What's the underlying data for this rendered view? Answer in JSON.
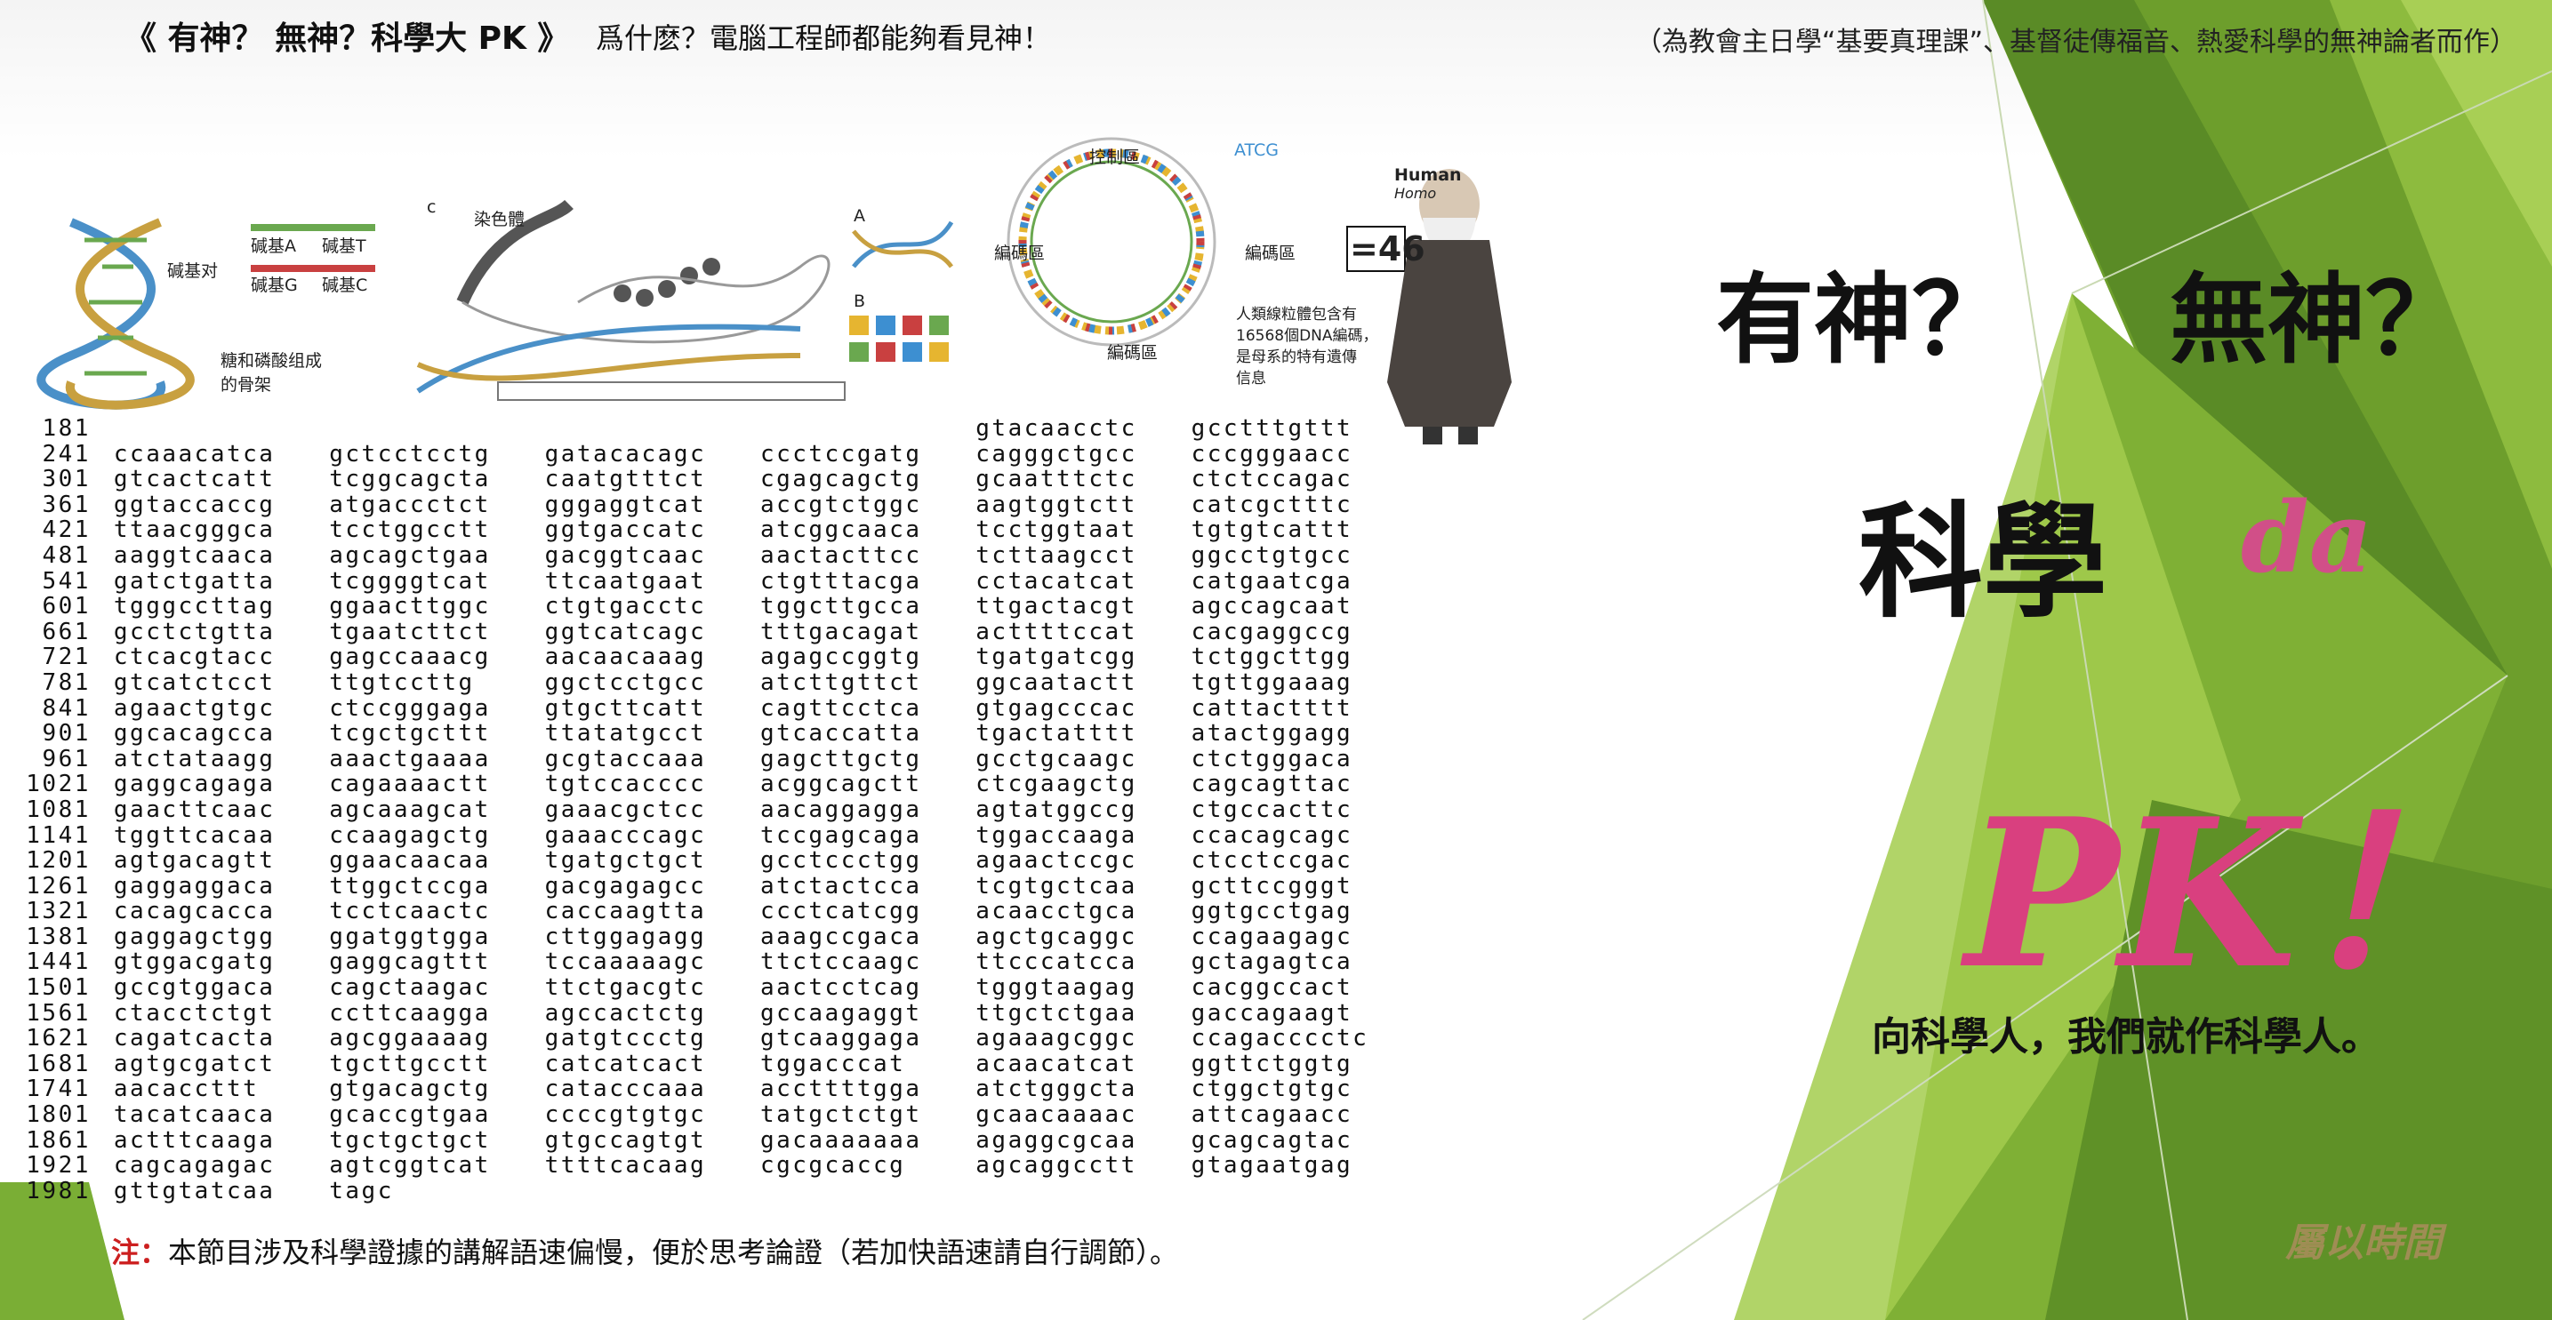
{
  "header": {
    "title": "《 有神？ 無神？科學大 PK 》",
    "subtitle": "爲什麽？電腦工程師都能夠看見神！",
    "note": "（為教會主日學“基要真理課”、基督徒傳福音、熱愛科學的無神論者而作）"
  },
  "hero": {
    "you_shen": "有神？",
    "wu_shen": "無神？",
    "science": "科學",
    "da": "da",
    "pk": "PK！",
    "slogan": "向科學人，我們就作科學人。",
    "watermark": "屬以時間"
  },
  "illustrations": {
    "base_pair": "碱基对",
    "base_a": "碱基A",
    "base_t": "碱基T",
    "base_g": "碱基G",
    "base_c": "碱基C",
    "backbone": "糖和磷酸组成\n的骨架",
    "chromosome": "染色體",
    "mito_control": "控制區",
    "coding_left": "編碼區",
    "coding_right": "編碼區",
    "coding_bottom": "編碼區",
    "mito_desc": "人類線粒體包含有\n16568個DNA編碼，\n是母系的特有遺傳\n信息",
    "human": "Human",
    "homo": "Homo",
    "chromosome_count": "=46",
    "panel_a": "A",
    "panel_b": "B",
    "panel_c": "c",
    "atcg": "ATCG"
  },
  "dna_sequence": [
    {
      "n": "181",
      "s": [
        "",
        "",
        "",
        "",
        "gtacaacctc",
        "gcctttgttt"
      ]
    },
    {
      "n": "241",
      "s": [
        "ccaaacatca",
        "gctcctcctg",
        "gatacacagc",
        "ccctccgatg",
        "cagggctgcc",
        "cccgggaacc"
      ]
    },
    {
      "n": "301",
      "s": [
        "gtcactcatt",
        "tcggcagcta",
        "caatgtttct",
        "cgagcagctg",
        "gcaatttctc",
        "ctctccagac"
      ]
    },
    {
      "n": "361",
      "s": [
        "ggtaccaccg",
        "atgaccctct",
        "gggaggtcat",
        "accgtctggc",
        "aagtggtctt",
        "catcgctttc"
      ]
    },
    {
      "n": "421",
      "s": [
        "ttaacgggca",
        "tcctggcctt",
        "ggtgaccatc",
        "atcggcaaca",
        "tcctggtaat",
        "tgtgtcattt"
      ]
    },
    {
      "n": "481",
      "s": [
        "aaggtcaaca",
        "agcagctgaa",
        "gacggtcaac",
        "aactacttcc",
        "tcttaagcct",
        "ggcctgtgcc"
      ]
    },
    {
      "n": "541",
      "s": [
        "gatctgatta",
        "tcggggtcat",
        "ttcaatgaat",
        "ctgtttacga",
        "cctacatcat",
        "catgaatcga"
      ]
    },
    {
      "n": "601",
      "s": [
        "tgggccttag",
        "ggaacttggc",
        "ctgtgacctc",
        "tggcttgcca",
        "ttgactacgt",
        "agccagcaat"
      ]
    },
    {
      "n": "661",
      "s": [
        "gcctctgtta",
        "tgaatcttct",
        "ggtcatcagc",
        "tttgacagat",
        "acttttccat",
        "cacgaggccg"
      ]
    },
    {
      "n": "721",
      "s": [
        "ctcacgtacc",
        "gagccaaacg",
        "aacaacaaag",
        "agagccggtg",
        "tgatgatcgg",
        "tctggcttgg"
      ]
    },
    {
      "n": "781",
      "s": [
        "gtcatctcct",
        "ttgtccttg",
        "ggctcctgcc",
        "atcttgttct",
        "ggcaatactt",
        "tgttggaaag"
      ]
    },
    {
      "n": "841",
      "s": [
        "agaactgtgc",
        "ctccgggaga",
        "gtgcttcatt",
        "cagttcctca",
        "gtgagcccac",
        "cattactttt"
      ]
    },
    {
      "n": "901",
      "s": [
        "ggcacagcca",
        "tcgctgcttt",
        "ttatatgcct",
        "gtcaccatta",
        "tgactatttt",
        "atactggagg"
      ]
    },
    {
      "n": "961",
      "s": [
        "atctataagg",
        "aaactgaaaa",
        "gcgtaccaaa",
        "gagcttgctg",
        "gcctgcaagc",
        "ctctgggaca"
      ]
    },
    {
      "n": "1021",
      "s": [
        "gaggcagaga",
        "cagaaaactt",
        "tgtccacccc",
        "acggcagctt",
        "ctcgaagctg",
        "cagcagttac"
      ]
    },
    {
      "n": "1081",
      "s": [
        "gaacttcaac",
        "agcaaagcat",
        "gaaacgctcc",
        "aacaggagga",
        "agtatggccg",
        "ctgccacttc"
      ]
    },
    {
      "n": "1141",
      "s": [
        "tggttcacaa",
        "ccaagagctg",
        "gaaacccagc",
        "tccgagcaga",
        "tggaccaaga",
        "ccacagcagc"
      ]
    },
    {
      "n": "1201",
      "s": [
        "agtgacagtt",
        "ggaacaacaa",
        "tgatgctgct",
        "gcctccctgg",
        "agaactccgc",
        "ctcctccgac"
      ]
    },
    {
      "n": "1261",
      "s": [
        "gaggaggaca",
        "ttggctccga",
        "gacgagagcc",
        "atctactcca",
        "tcgtgctcaa",
        "gcttccgggt"
      ]
    },
    {
      "n": "1321",
      "s": [
        "cacagcacca",
        "tcctcaactc",
        "caccaagtta",
        "ccctcatcgg",
        "acaacctgca",
        "ggtgcctgag"
      ]
    },
    {
      "n": "1381",
      "s": [
        "gaggagctgg",
        "ggatggtgga",
        "cttggagagg",
        "aaagccgaca",
        "agctgcaggc",
        "ccagaagagc"
      ]
    },
    {
      "n": "1441",
      "s": [
        "gtggacgatg",
        "gaggcagttt",
        "tccaaaaagc",
        "ttctccaagc",
        "ttcccatcca",
        "gctagagtca"
      ]
    },
    {
      "n": "1501",
      "s": [
        "gccgtggaca",
        "cagctaagac",
        "ttctgacgtc",
        "aactcctcag",
        "tgggtaagag",
        "cacggccact"
      ]
    },
    {
      "n": "1561",
      "s": [
        "ctacctctgt",
        "ccttcaagga",
        "agccactctg",
        "gccaagaggt",
        "ttgctctgaa",
        "gaccagaagt"
      ]
    },
    {
      "n": "1621",
      "s": [
        "cagatcacta",
        "agcggaaaag",
        "gatgtccctg",
        "gtcaaggaga",
        "agaaagcggc",
        "ccagacccctc"
      ]
    },
    {
      "n": "1681",
      "s": [
        "agtgcgatct",
        "tgcttgcctt",
        "catcatcact",
        "tggacccat",
        "acaacatcat",
        "ggttctggtg"
      ]
    },
    {
      "n": "1741",
      "s": [
        "aacaccttt",
        "gtgacagctg",
        "catacccaaa",
        "accttttgga",
        "atctgggcta",
        "ctggctgtgc"
      ]
    },
    {
      "n": "1801",
      "s": [
        "tacatcaaca",
        "gcaccgtgaa",
        "ccccgtgtgc",
        "tatgctctgt",
        "gcaacaaaac",
        "attcagaacc"
      ]
    },
    {
      "n": "1861",
      "s": [
        "actttcaaga",
        "tgctgctgct",
        "gtgccagtgt",
        "gacaaaaaaa",
        "agaggcgcaa",
        "gcagcagtac"
      ]
    },
    {
      "n": "1921",
      "s": [
        "cagcagagac",
        "agtcggtcat",
        "ttttcacaag",
        "cgcgcaccg",
        "agcaggcctt",
        "gtagaatgag"
      ]
    },
    {
      "n": "1981",
      "s": [
        "gttgtatcaa",
        "tagc",
        "",
        "",
        "",
        ""
      ]
    }
  ],
  "footer": {
    "label": "注：",
    "text": "本節目涉及科學證據的講解語速偏慢，便於思考論證（若加快語速請自行調節）。"
  },
  "colors": {
    "green_dark": "#4e7d24",
    "green_mid": "#7aae35",
    "green_light": "#a9cf58",
    "pink": "#d9407f",
    "red": "#cc1f1f"
  }
}
